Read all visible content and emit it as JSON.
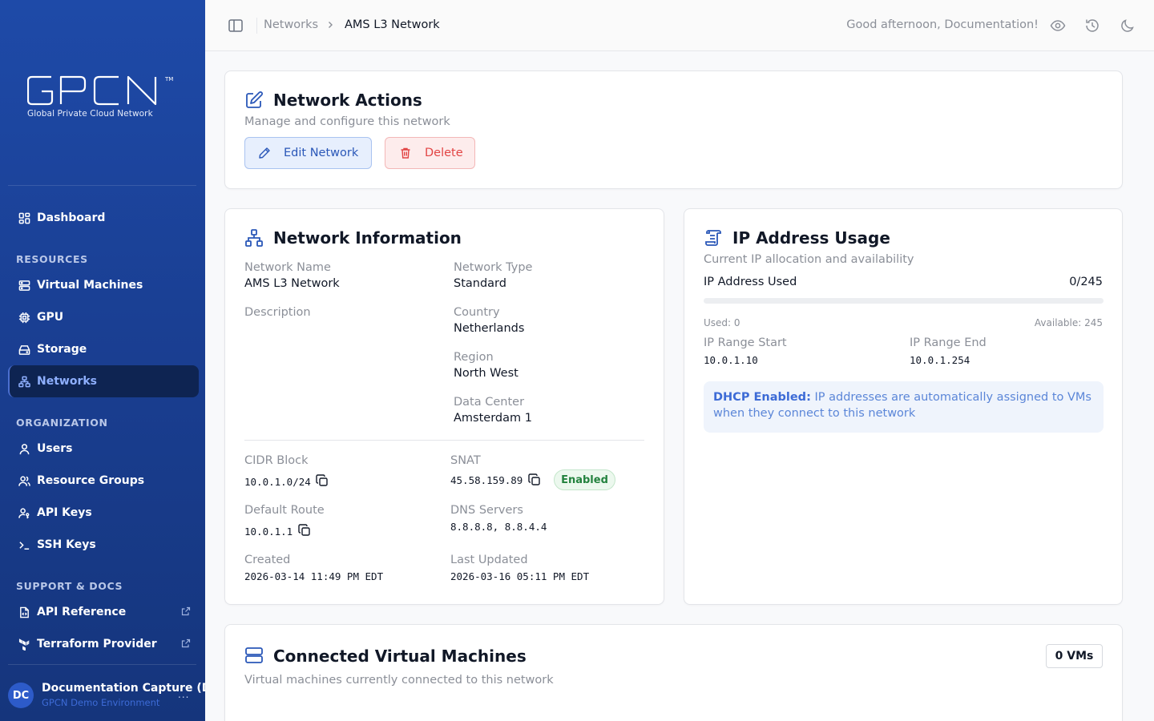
{
  "brand": {
    "logo_text": "GPCN",
    "trademark": "TM",
    "tagline": "Global Private Cloud Network"
  },
  "sidebar": {
    "dashboard": "Dashboard",
    "sections": {
      "resources": "RESOURCES",
      "organization": "ORGANIZATION",
      "support": "SUPPORT & DOCS"
    },
    "resources": [
      {
        "label": "Virtual Machines",
        "icon": "server-icon"
      },
      {
        "label": "GPU",
        "icon": "chip-icon"
      },
      {
        "label": "Storage",
        "icon": "storage-icon"
      },
      {
        "label": "Networks",
        "icon": "network-icon",
        "active": true
      }
    ],
    "organization": [
      {
        "label": "Users",
        "icon": "user-icon"
      },
      {
        "label": "Resource Groups",
        "icon": "users-icon"
      },
      {
        "label": "API Keys",
        "icon": "user-key-icon"
      },
      {
        "label": "SSH Keys",
        "icon": "terminal-icon"
      }
    ],
    "support": [
      {
        "label": "API Reference",
        "icon": "file-code-icon"
      },
      {
        "label": "Terraform Provider",
        "icon": "terraform-icon"
      }
    ],
    "user": {
      "initials": "DC",
      "name": "Documentation Capture (Do",
      "environment": "GPCN Demo Environment",
      "more": "..."
    }
  },
  "topbar": {
    "breadcrumb": [
      "Networks",
      "AMS L3 Network"
    ],
    "greeting": "Good afternoon, Documentation!"
  },
  "actions_card": {
    "title": "Network Actions",
    "subtitle": "Manage and configure this network",
    "edit_label": "Edit Network",
    "delete_label": "Delete"
  },
  "info_card": {
    "title": "Network Information",
    "fields": {
      "network_name": {
        "label": "Network Name",
        "value": "AMS L3 Network"
      },
      "network_type": {
        "label": "Network Type",
        "value": "Standard"
      },
      "description": {
        "label": "Description",
        "value": ""
      },
      "country": {
        "label": "Country",
        "value": "Netherlands"
      },
      "region": {
        "label": "Region",
        "value": "North West"
      },
      "data_center": {
        "label": "Data Center",
        "value": "Amsterdam 1"
      },
      "cidr": {
        "label": "CIDR Block",
        "value": "10.0.1.0/24"
      },
      "snat": {
        "label": "SNAT",
        "value": "45.58.159.89",
        "status": "Enabled"
      },
      "default_route": {
        "label": "Default Route",
        "value": "10.0.1.1"
      },
      "dns": {
        "label": "DNS Servers",
        "value": "8.8.8.8, 8.8.4.4"
      },
      "created": {
        "label": "Created",
        "value": "2026-03-14 11:49 PM EDT"
      },
      "updated": {
        "label": "Last Updated",
        "value": "2026-03-16 05:11 PM EDT"
      }
    }
  },
  "ip_card": {
    "title": "IP Address Usage",
    "subtitle": "Current IP allocation and availability",
    "used_label": "IP Address Used",
    "used_ratio": "0/245",
    "used_fraction": 0,
    "used_text": "Used: 0",
    "available_text": "Available: 245",
    "range_start_label": "IP Range Start",
    "range_start": "10.0.1.10",
    "range_end_label": "IP Range End",
    "range_end": "10.0.1.254",
    "dhcp_strong": "DHCP Enabled:",
    "dhcp_text": "IP addresses are automatically assigned to VMs when they connect to this network"
  },
  "vms_card": {
    "title": "Connected Virtual Machines",
    "subtitle": "Virtual machines currently connected to this network",
    "count": "0 VMs"
  },
  "colors": {
    "sidebar_top": "#1e4aa8",
    "accent": "#2a57b8",
    "danger": "#e24444",
    "success": "#23823e"
  }
}
